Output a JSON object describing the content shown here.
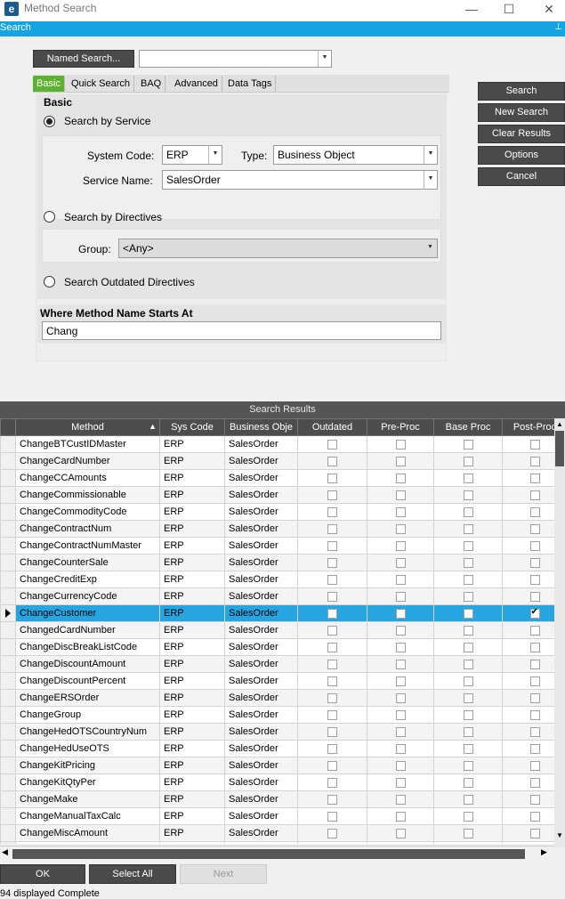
{
  "window": {
    "title": "Method Search",
    "icon_letter": "e",
    "minimize": "—",
    "maximize": "☐",
    "close": "✕"
  },
  "searchbar": {
    "label": "Search",
    "pin": "📌"
  },
  "named_search": {
    "button": "Named Search...",
    "value": ""
  },
  "tabs": [
    "Basic",
    "Quick Search",
    "BAQ",
    "Advanced",
    "Data Tags"
  ],
  "basic": {
    "heading": "Basic",
    "by_service": "Search by Service",
    "system_code_label": "System Code:",
    "system_code_value": "ERP",
    "type_label": "Type:",
    "type_value": "Business Object",
    "service_name_label": "Service Name:",
    "service_name_value": "SalesOrder",
    "by_directives": "Search by Directives",
    "group_label": "Group:",
    "group_value": "<Any>",
    "outdated": "Search Outdated Directives"
  },
  "where": {
    "heading": "Where Method Name Starts At",
    "value": "Chang"
  },
  "actions": {
    "search": "Search",
    "new_search": "New Search",
    "clear_results": "Clear Results",
    "options": "Options",
    "cancel": "Cancel"
  },
  "results": {
    "title": "Search Results",
    "columns": [
      "Method",
      "Sys Code",
      "Business Obje",
      "Outdated",
      "Pre-Proc",
      "Base Proc",
      "Post-Proc"
    ],
    "sort_indicator": "▲",
    "selected_index": 10,
    "rows": [
      {
        "method": "ChangeBTCustIDMaster",
        "sys": "ERP",
        "bo": "SalesOrder",
        "post": false
      },
      {
        "method": "ChangeCardNumber",
        "sys": "ERP",
        "bo": "SalesOrder",
        "post": false
      },
      {
        "method": "ChangeCCAmounts",
        "sys": "ERP",
        "bo": "SalesOrder",
        "post": false
      },
      {
        "method": "ChangeCommissionable",
        "sys": "ERP",
        "bo": "SalesOrder",
        "post": false
      },
      {
        "method": "ChangeCommodityCode",
        "sys": "ERP",
        "bo": "SalesOrder",
        "post": false
      },
      {
        "method": "ChangeContractNum",
        "sys": "ERP",
        "bo": "SalesOrder",
        "post": false
      },
      {
        "method": "ChangeContractNumMaster",
        "sys": "ERP",
        "bo": "SalesOrder",
        "post": false
      },
      {
        "method": "ChangeCounterSale",
        "sys": "ERP",
        "bo": "SalesOrder",
        "post": false
      },
      {
        "method": "ChangeCreditExp",
        "sys": "ERP",
        "bo": "SalesOrder",
        "post": false
      },
      {
        "method": "ChangeCurrencyCode",
        "sys": "ERP",
        "bo": "SalesOrder",
        "post": false
      },
      {
        "method": "ChangeCustomer",
        "sys": "ERP",
        "bo": "SalesOrder",
        "post": true
      },
      {
        "method": "ChangedCardNumber",
        "sys": "ERP",
        "bo": "SalesOrder",
        "post": false
      },
      {
        "method": "ChangeDiscBreakListCode",
        "sys": "ERP",
        "bo": "SalesOrder",
        "post": false
      },
      {
        "method": "ChangeDiscountAmount",
        "sys": "ERP",
        "bo": "SalesOrder",
        "post": false
      },
      {
        "method": "ChangeDiscountPercent",
        "sys": "ERP",
        "bo": "SalesOrder",
        "post": false
      },
      {
        "method": "ChangeERSOrder",
        "sys": "ERP",
        "bo": "SalesOrder",
        "post": false
      },
      {
        "method": "ChangeGroup",
        "sys": "ERP",
        "bo": "SalesOrder",
        "post": false
      },
      {
        "method": "ChangeHedOTSCountryNum",
        "sys": "ERP",
        "bo": "SalesOrder",
        "post": false
      },
      {
        "method": "ChangeHedUseOTS",
        "sys": "ERP",
        "bo": "SalesOrder",
        "post": false
      },
      {
        "method": "ChangeKitPricing",
        "sys": "ERP",
        "bo": "SalesOrder",
        "post": false
      },
      {
        "method": "ChangeKitQtyPer",
        "sys": "ERP",
        "bo": "SalesOrder",
        "post": false
      },
      {
        "method": "ChangeMake",
        "sys": "ERP",
        "bo": "SalesOrder",
        "post": false
      },
      {
        "method": "ChangeManualTaxCalc",
        "sys": "ERP",
        "bo": "SalesOrder",
        "post": false
      },
      {
        "method": "ChangeMiscAmount",
        "sys": "ERP",
        "bo": "SalesOrder",
        "post": false
      },
      {
        "method": "ChangeMiscCode",
        "sys": "ERP",
        "bo": "SalesOrder",
        "post": false
      }
    ]
  },
  "footer": {
    "ok": "OK",
    "select_all": "Select All",
    "next": "Next",
    "status": "94 displayed Complete"
  }
}
